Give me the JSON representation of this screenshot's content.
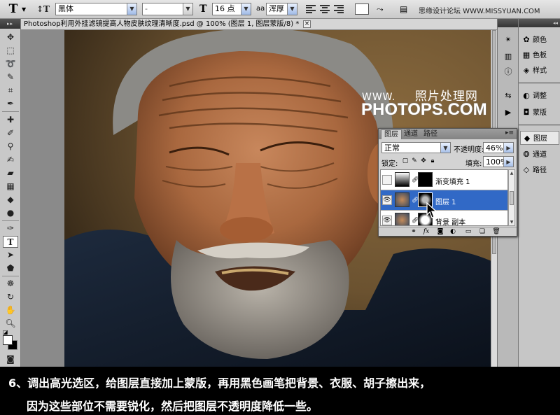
{
  "options_bar": {
    "tool_icon": "T",
    "orientation_icon": "text-orientation-icon",
    "font_family": "黑体",
    "font_style": "-",
    "font_size": "16 点",
    "aa_icon": "aa",
    "antialias": "浑厚",
    "watermark": "思缘设计论坛  WWW.MISSYUAN.COM"
  },
  "document": {
    "title": "Photoshop利用外挂滤镜提高人物皮肤纹理清晰度.psd @ 100% (图层 1, 图层蒙版/8) *",
    "close_label": "×"
  },
  "image_watermark": {
    "line1": "WWW.",
    "line1_cn": "照片处理网",
    "line2": "PHOTOPS.COM"
  },
  "dock": {
    "items": [
      {
        "icon": "color-icon",
        "label": "颜色"
      },
      {
        "icon": "swatches-icon",
        "label": "色板"
      },
      {
        "icon": "styles-icon",
        "label": "样式"
      },
      {
        "icon": "adjustments-icon",
        "label": "调整"
      },
      {
        "icon": "masks-icon",
        "label": "蒙版"
      },
      {
        "icon": "layers-icon",
        "label": "图层"
      },
      {
        "icon": "channels-icon",
        "label": "通道"
      },
      {
        "icon": "paths-icon",
        "label": "路径"
      }
    ]
  },
  "layers_panel": {
    "tabs": [
      "图层",
      "通道",
      "路径"
    ],
    "menu": "▸≡",
    "blend_mode": "正常",
    "opacity_label": "不透明度:",
    "opacity_value": "46%",
    "lock_label": "锁定:",
    "fill_label": "填充:",
    "fill_value": "100%",
    "layers": [
      {
        "name": "渐变填充 1",
        "visible": false,
        "selected": false
      },
      {
        "name": "图层 1",
        "visible": true,
        "selected": true
      },
      {
        "name": "背景 副本",
        "visible": true,
        "selected": false
      }
    ],
    "bottom_icons": [
      "link-icon",
      "fx-icon",
      "mask-icon",
      "adjustment-icon",
      "group-icon",
      "new-layer-icon",
      "trash-icon"
    ]
  },
  "caption": {
    "line1": "6、调出高光选区，给图层直接加上蒙版，再用黑色画笔把背景、衣服、胡子擦出来，",
    "line2": "因为这些部位不需要锐化，然后把图层不透明度降低一些。"
  },
  "colors": {
    "selection_blue": "#3169c6",
    "panel_gray": "#d3d3d3",
    "foreground": "#ffffff",
    "background": "#000000"
  }
}
